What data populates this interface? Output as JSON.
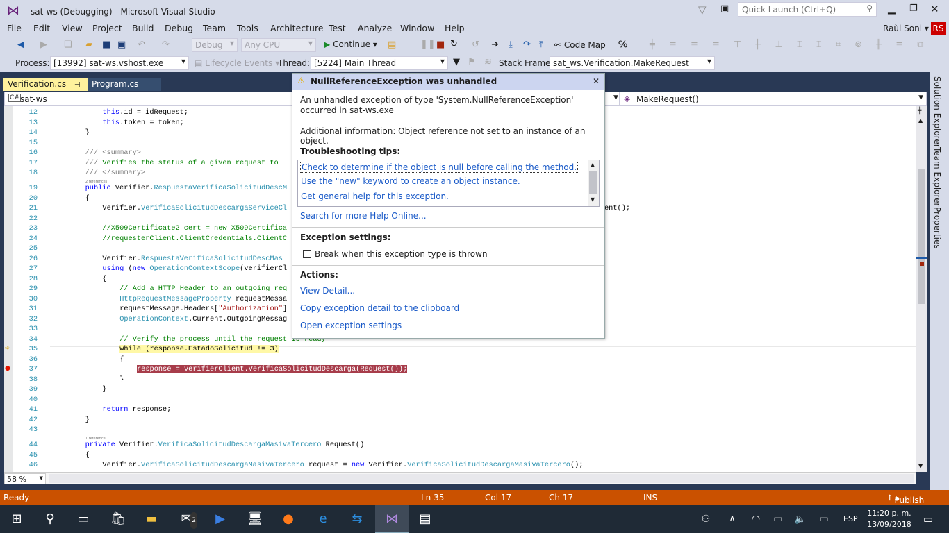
{
  "window": {
    "title": "sat-ws (Debugging) - Microsoft Visual Studio",
    "quick_launch_placeholder": "Quick Launch (Ctrl+Q)",
    "user": "Raùl Soni",
    "user_initials": "RS",
    "accent": "#ca5100"
  },
  "menu": [
    "File",
    "Edit",
    "View",
    "Project",
    "Build",
    "Debug",
    "Team",
    "Tools",
    "Architecture",
    "Test",
    "Analyze",
    "Window",
    "Help"
  ],
  "toolbar": {
    "config": "Debug",
    "platform": "Any CPU",
    "continue": "Continue",
    "code_map": "Code Map"
  },
  "debug_bar": {
    "process_label": "Process:",
    "process": "[13992] sat-ws.vshost.exe",
    "lifecycle": "Lifecycle Events",
    "thread_label": "Thread:",
    "thread": "[5224] Main Thread",
    "stack_label": "Stack Frame:",
    "stack": "sat_ws.Verification.MakeRequest"
  },
  "tabs": [
    {
      "label": "Verification.cs",
      "active": true
    },
    {
      "label": "Program.cs",
      "active": false
    }
  ],
  "navbar": {
    "project": "sat-ws",
    "member": "MakeRequest()"
  },
  "code": [
    {
      "n": 12,
      "i": 12,
      "tk": [
        [
          "this",
          "k"
        ],
        [
          ".id = idRequest;",
          ""
        ]
      ]
    },
    {
      "n": 13,
      "i": 12,
      "tk": [
        [
          "this",
          "k"
        ],
        [
          ".token = token;",
          ""
        ]
      ]
    },
    {
      "n": 14,
      "i": 8,
      "tk": [
        [
          "}",
          ""
        ]
      ]
    },
    {
      "n": 15,
      "i": 0,
      "tk": []
    },
    {
      "n": 16,
      "i": 8,
      "tk": [
        [
          "/// <summary>",
          "d"
        ]
      ]
    },
    {
      "n": 17,
      "i": 8,
      "tk": [
        [
          "///",
          "d"
        ],
        [
          " Verifies the status of a given request to",
          "c"
        ]
      ]
    },
    {
      "n": 18,
      "i": 8,
      "tk": [
        [
          "/// </summary>",
          "d"
        ]
      ]
    },
    {
      "n": 19,
      "i": 8,
      "lens": "2 references",
      "tk": [
        [
          "public",
          "k"
        ],
        [
          " Verifier.",
          ""
        ],
        [
          "RespuestaVerificaSolicitudDescM",
          "t"
        ]
      ]
    },
    {
      "n": 20,
      "i": 8,
      "tk": [
        [
          "{",
          ""
        ]
      ]
    },
    {
      "n": 21,
      "i": 12,
      "tk": [
        [
          "Verifier.",
          ""
        ],
        [
          "VerificaSolicitudDescargaServiceCl",
          "t"
        ]
      ],
      "tail": "ent();"
    },
    {
      "n": 22,
      "i": 0,
      "tk": []
    },
    {
      "n": 23,
      "i": 12,
      "tk": [
        [
          "//X509Certificate2 cert = new X509Certifica",
          "c"
        ]
      ]
    },
    {
      "n": 24,
      "i": 12,
      "tk": [
        [
          "//requesterClient.ClientCredentials.ClientC",
          "c"
        ]
      ]
    },
    {
      "n": 25,
      "i": 0,
      "tk": []
    },
    {
      "n": 26,
      "i": 12,
      "tk": [
        [
          "Verifier.",
          ""
        ],
        [
          "RespuestaVerificaSolicitudDescMas",
          "t"
        ]
      ]
    },
    {
      "n": 27,
      "i": 12,
      "tk": [
        [
          "using",
          "k"
        ],
        [
          " (",
          ""
        ],
        [
          "new",
          "k"
        ],
        [
          " ",
          ""
        ],
        [
          "OperationContextScope",
          "t"
        ],
        [
          "(verifierCl",
          ""
        ]
      ]
    },
    {
      "n": 28,
      "i": 12,
      "tk": [
        [
          "{",
          ""
        ]
      ]
    },
    {
      "n": 29,
      "i": 16,
      "tk": [
        [
          "// Add a HTTP Header to an outgoing req",
          "c"
        ]
      ]
    },
    {
      "n": 30,
      "i": 16,
      "tk": [
        [
          "HttpRequestMessageProperty",
          "t"
        ],
        [
          " requestMessa",
          ""
        ]
      ]
    },
    {
      "n": 31,
      "i": 16,
      "tk": [
        [
          "requestMessage.Headers[",
          ""
        ],
        [
          "\"Authorization\"",
          "s"
        ],
        [
          "]",
          ""
        ]
      ]
    },
    {
      "n": 32,
      "i": 16,
      "tk": [
        [
          "OperationContext",
          "t"
        ],
        [
          ".Current.OutgoingMessag",
          ""
        ]
      ]
    },
    {
      "n": 33,
      "i": 0,
      "tk": []
    },
    {
      "n": 34,
      "i": 16,
      "tk": [
        [
          "// Verify the process until the request is ready",
          "c"
        ]
      ]
    },
    {
      "n": 35,
      "i": 16,
      "hl": "y",
      "marker": "arrow",
      "tk": [
        [
          "while (response.EstadoSolicitud != 3)",
          ""
        ]
      ]
    },
    {
      "n": 36,
      "i": 16,
      "tk": [
        [
          "{",
          ""
        ]
      ]
    },
    {
      "n": 37,
      "i": 20,
      "hl": "r",
      "marker": "breakpoint",
      "tk": [
        [
          "response = verifierClient.VerificaSolicitudDescarga(Request());",
          ""
        ]
      ]
    },
    {
      "n": 38,
      "i": 16,
      "tk": [
        [
          "}",
          ""
        ]
      ]
    },
    {
      "n": 39,
      "i": 12,
      "tk": [
        [
          "}",
          ""
        ]
      ]
    },
    {
      "n": 40,
      "i": 0,
      "tk": []
    },
    {
      "n": 41,
      "i": 12,
      "tk": [
        [
          "return",
          "k"
        ],
        [
          " response;",
          ""
        ]
      ]
    },
    {
      "n": 42,
      "i": 8,
      "tk": [
        [
          "}",
          ""
        ]
      ]
    },
    {
      "n": 43,
      "i": 0,
      "tk": []
    },
    {
      "n": 44,
      "i": 8,
      "lens": "1 reference",
      "tk": [
        [
          "private",
          "k"
        ],
        [
          " Verifier.",
          ""
        ],
        [
          "VerificaSolicitudDescargaMasivaTercero",
          "t"
        ],
        [
          " Request()",
          ""
        ]
      ]
    },
    {
      "n": 45,
      "i": 8,
      "tk": [
        [
          "{",
          ""
        ]
      ]
    },
    {
      "n": 46,
      "i": 12,
      "tk": [
        [
          "Verifier.",
          ""
        ],
        [
          "VerificaSolicitudDescargaMasivaTercero",
          "t"
        ],
        [
          " request = ",
          ""
        ],
        [
          "new",
          "k"
        ],
        [
          " Verifier.",
          ""
        ],
        [
          "VerificaSolicitudDescargaMasivaTercero",
          "t"
        ],
        [
          "();",
          ""
        ]
      ]
    }
  ],
  "zoom": "58 %",
  "right_tabs": [
    "Solution Explorer",
    "Team Explorer",
    "Properties"
  ],
  "exception": {
    "title": "NullReferenceException was unhandled",
    "message": "An unhandled exception of type 'System.NullReferenceException' occurred in sat-ws.exe",
    "info": "Additional information: Object reference not set to an instance of an object.",
    "tips_header": "Troubleshooting tips:",
    "tips": [
      "Check to determine if the object is null before calling the method.",
      "Use the \"new\" keyword to create an object instance.",
      "Get general help for this exception."
    ],
    "search_help": "Search for more Help Online...",
    "settings_header": "Exception settings:",
    "break_checkbox": "Break when this exception type is thrown",
    "break_checked": false,
    "actions_header": "Actions:",
    "actions": [
      "View Detail...",
      "Copy exception detail to the clipboard",
      "Open exception settings"
    ]
  },
  "status": {
    "state": "Ready",
    "ln": "Ln 35",
    "col": "Col 17",
    "ch": "Ch 17",
    "mode": "INS",
    "publish": "Publish"
  },
  "taskbar": {
    "language": "ESP",
    "time": "11:20 p. m.",
    "date": "13/09/2018",
    "mail_badge": "2"
  }
}
